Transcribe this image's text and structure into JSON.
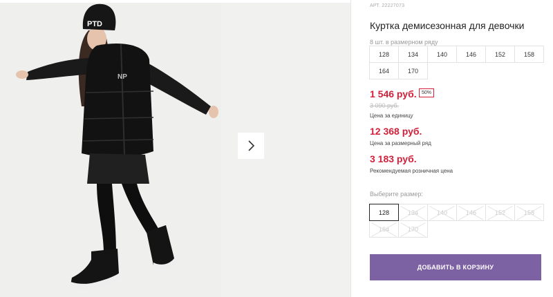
{
  "product": {
    "sku": "АРТ. 22227073",
    "title": "Куртка демисезонная для девочки",
    "series_note": "8 шт. в размерном ряду",
    "series_sizes": [
      "128",
      "134",
      "140",
      "146",
      "152",
      "158",
      "164",
      "170"
    ],
    "price": "1 546 руб.",
    "discount_badge": "50%",
    "old_price": "3 090 руб.",
    "price_caption": "Цена за единицу",
    "series_price": "12 368 руб.",
    "series_price_caption": "Цена за размерный ряд",
    "retail_price": "3 183 руб.",
    "retail_caption": "Рекомендуемая розничная цена",
    "choose_size_label": "Выберите размер:",
    "pick_sizes": [
      {
        "label": "128",
        "state": "selected"
      },
      {
        "label": "134",
        "state": "disabled"
      },
      {
        "label": "140",
        "state": "disabled"
      },
      {
        "label": "146",
        "state": "disabled"
      },
      {
        "label": "152",
        "state": "disabled"
      },
      {
        "label": "158",
        "state": "disabled"
      },
      {
        "label": "164",
        "state": "disabled"
      },
      {
        "label": "170",
        "state": "disabled"
      }
    ],
    "add_to_cart_label": "ДОБАВИТЬ В КОРЗИНУ",
    "hat_print": "PTD",
    "jacket_print": "NP"
  },
  "colors": {
    "accent": "#7c61a3",
    "price_red": "#d3203a"
  },
  "icons": {
    "next": "chevron-right-icon"
  }
}
